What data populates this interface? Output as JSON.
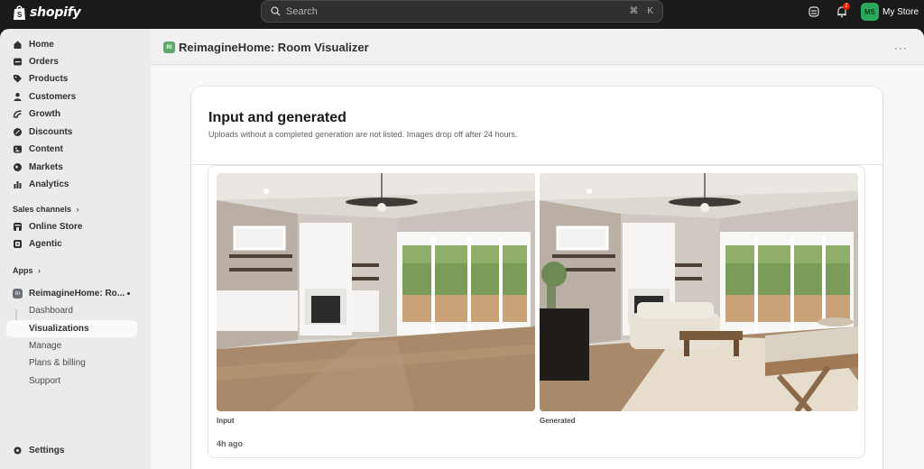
{
  "topbar": {
    "logo_text": "shopify",
    "search_placeholder": "Search",
    "search_shortcut_cmd": "⌘",
    "search_shortcut_key": "K",
    "notification_count": "2",
    "store_initials": "MS",
    "store_name": "My Store"
  },
  "sidebar": {
    "items": [
      {
        "label": "Home",
        "icon": "home-icon"
      },
      {
        "label": "Orders",
        "icon": "orders-icon"
      },
      {
        "label": "Products",
        "icon": "tag-icon"
      },
      {
        "label": "Customers",
        "icon": "person-icon"
      },
      {
        "label": "Growth",
        "icon": "growth-icon"
      },
      {
        "label": "Discounts",
        "icon": "discount-icon"
      },
      {
        "label": "Content",
        "icon": "content-icon"
      },
      {
        "label": "Markets",
        "icon": "globe-icon"
      },
      {
        "label": "Analytics",
        "icon": "bar-chart-icon"
      }
    ],
    "sales_channels_label": "Sales channels",
    "channels": [
      {
        "label": "Online Store",
        "icon": "store-icon"
      },
      {
        "label": "Agentic",
        "icon": "agentic-icon"
      }
    ],
    "apps_label": "Apps",
    "app": {
      "name": "ReimagineHome: Ro...",
      "icon_text": "RI",
      "subitems": [
        "Dashboard",
        "Visualizations",
        "Manage",
        "Plans & billing",
        "Support"
      ],
      "active": "Visualizations"
    },
    "settings_label": "Settings"
  },
  "header": {
    "app_logo_text": "RI",
    "title": "ReimagineHome: Room Visualizer",
    "more": "···"
  },
  "card": {
    "title": "Input and generated",
    "subtitle": "Uploads without a completed generation are not listed. Images drop off after 24 hours.",
    "input_label": "Input",
    "generated_label": "Generated",
    "time": "4h ago"
  },
  "colors": {
    "topbar_bg": "#1a1a1a",
    "sidebar_bg": "#ebebeb",
    "avatar_green": "#2aa958",
    "badge_red": "#e51c00"
  }
}
